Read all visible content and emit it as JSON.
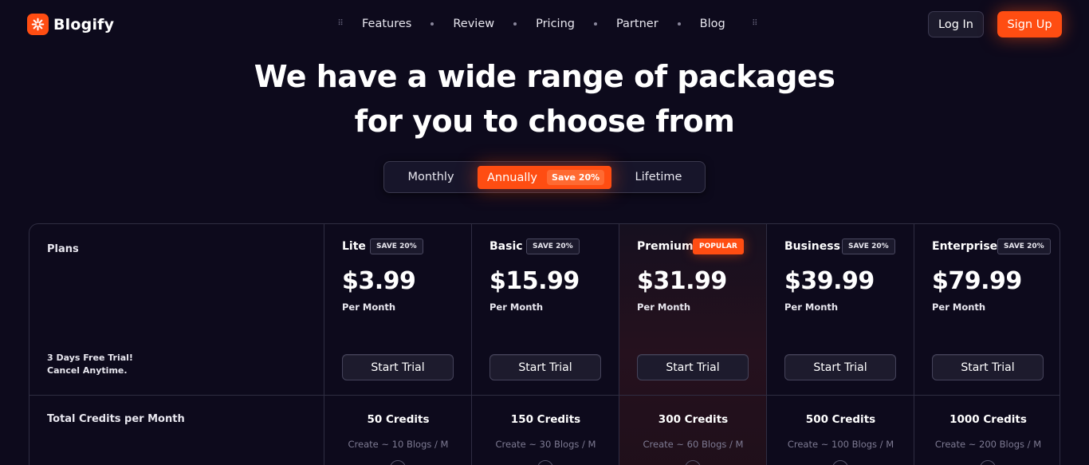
{
  "brand": {
    "name": "Blogify",
    "icon": "flower-logo-icon",
    "accent": "#ff4d12"
  },
  "nav": {
    "links": [
      "Features",
      "Review",
      "Pricing",
      "Partner",
      "Blog"
    ],
    "login_label": "Log In",
    "signup_label": "Sign Up"
  },
  "hero": {
    "line1": "We have a wide range of packages",
    "line2": "for you to choose from"
  },
  "billing_toggle": {
    "options": [
      "Monthly",
      "Annually",
      "Lifetime"
    ],
    "selected": "Annually",
    "save_badge": "Save 20%"
  },
  "plans_table": {
    "header_label": "Plans",
    "trial_line1": "3 Days Free Trial!",
    "trial_line2": "Cancel Anytime.",
    "credits_row_label": "Total Credits per Month",
    "plans": [
      {
        "name": "Lite",
        "badge": "SAVE 20%",
        "price": "$3.99",
        "period": "Per Month",
        "cta": "Start Trial",
        "credits": "50 Credits",
        "blogs": "Create ~ 10 Blogs / M"
      },
      {
        "name": "Basic",
        "badge": "SAVE 20%",
        "price": "$15.99",
        "period": "Per Month",
        "cta": "Start Trial",
        "credits": "150 Credits",
        "blogs": "Create ~ 30 Blogs / M"
      },
      {
        "name": "Premium",
        "badge": "POPULAR",
        "price": "$31.99",
        "period": "Per Month",
        "cta": "Start Trial",
        "credits": "300 Credits",
        "blogs": "Create ~ 60 Blogs / M"
      },
      {
        "name": "Business",
        "badge": "SAVE 20%",
        "price": "$39.99",
        "period": "Per Month",
        "cta": "Start Trial",
        "credits": "500 Credits",
        "blogs": "Create ~ 100 Blogs / M"
      },
      {
        "name": "Enterprise",
        "badge": "SAVE 20%",
        "price": "$79.99",
        "period": "Per Month",
        "cta": "Start Trial",
        "credits": "1000 Credits",
        "blogs": "Create ~ 200 Blogs / M"
      }
    ]
  }
}
